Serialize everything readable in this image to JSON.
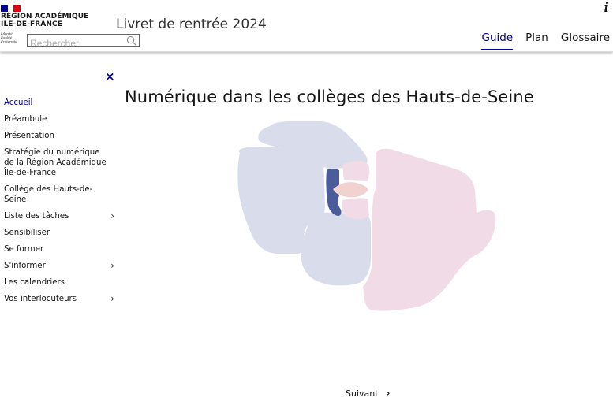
{
  "header": {
    "logo_line1": "RÉGION ACADÉMIQUE",
    "logo_line2": "ÎLE-DE-FRANCE",
    "motto_line1": "Liberté",
    "motto_line2": "Égalité",
    "motto_line3": "Fraternité",
    "site_title": "Livret de rentrée 2024",
    "search_placeholder": "Rechercher",
    "info_glyph": "i"
  },
  "nav": {
    "items": [
      {
        "label": "Guide",
        "active": true
      },
      {
        "label": "Plan",
        "active": false
      },
      {
        "label": "Glossaire",
        "active": false
      }
    ]
  },
  "sidebar": {
    "close_glyph": "×",
    "items": [
      {
        "label": "Accueil",
        "active": true,
        "has_children": false
      },
      {
        "label": "Préambule",
        "active": false,
        "has_children": false
      },
      {
        "label": "Présentation",
        "active": false,
        "has_children": false
      },
      {
        "label": "Stratégie du numérique de la Région Académique Île-de-France",
        "active": false,
        "has_children": false
      },
      {
        "label": "Collège des Hauts-de-Seine",
        "active": false,
        "has_children": false
      },
      {
        "label": "Liste des tâches",
        "active": false,
        "has_children": true
      },
      {
        "label": "Sensibiliser",
        "active": false,
        "has_children": false
      },
      {
        "label": "Se former",
        "active": false,
        "has_children": false
      },
      {
        "label": "S'informer",
        "active": false,
        "has_children": true
      },
      {
        "label": "Les calendriers",
        "active": false,
        "has_children": false
      },
      {
        "label": "Vos interlocuteurs",
        "active": false,
        "has_children": true
      }
    ],
    "chevron_glyph": "›"
  },
  "main": {
    "title": "Numérique dans les collèges des Hauts-de-Seine",
    "next_label": "Suivant",
    "next_glyph": "›"
  },
  "colors": {
    "brand_blue": "#000091",
    "map_left": "#d9dcea",
    "map_right": "#f0dbe6",
    "map_dark": "#4a5c99",
    "map_salmon": "#f2d2d0"
  }
}
